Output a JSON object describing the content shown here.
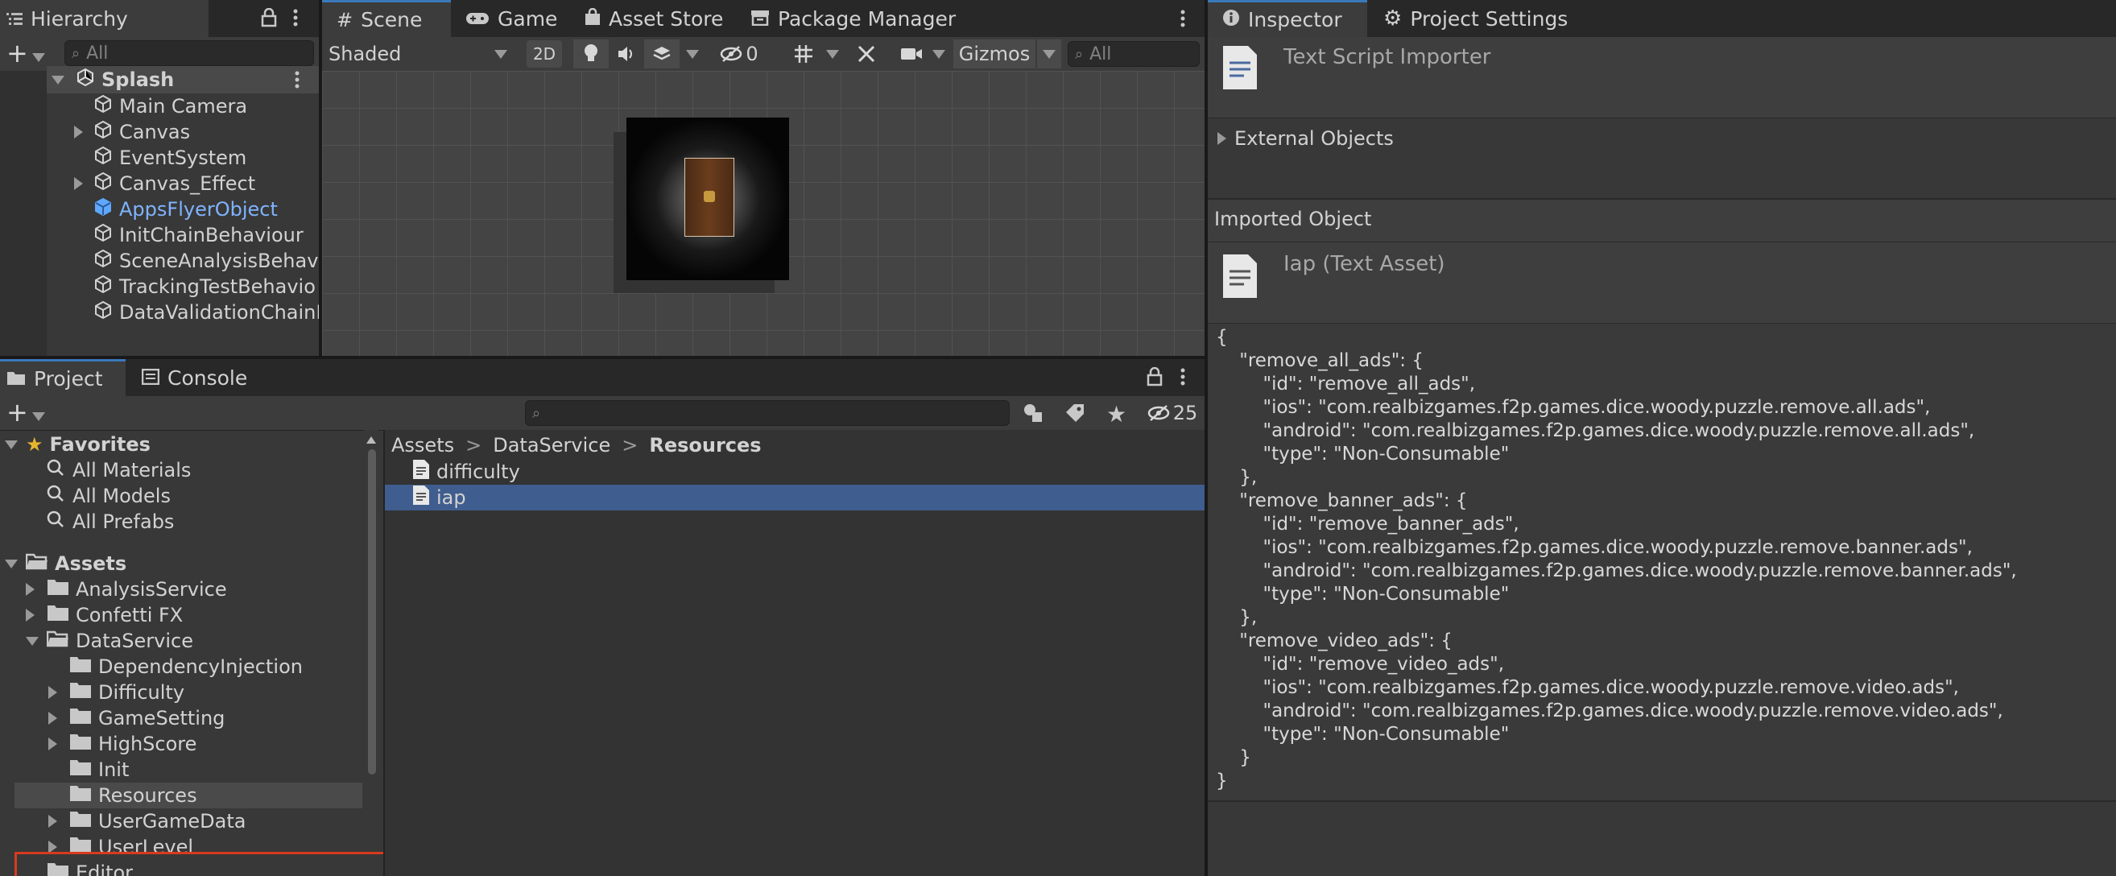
{
  "hierarchy": {
    "tab_label": "Hierarchy",
    "search_placeholder": "All",
    "scene_name": "Splash",
    "items": [
      {
        "label": "Main Camera",
        "expandable": false
      },
      {
        "label": "Canvas",
        "expandable": true
      },
      {
        "label": "EventSystem",
        "expandable": false
      },
      {
        "label": "Canvas_Effect",
        "expandable": true
      },
      {
        "label": "AppsFlyerObject",
        "expandable": false,
        "highlight": true
      },
      {
        "label": "InitChainBehaviour",
        "expandable": false
      },
      {
        "label": "SceneAnalysisBehavi",
        "expandable": false
      },
      {
        "label": "TrackingTestBehavio",
        "expandable": false
      },
      {
        "label": "DataValidationChainB",
        "expandable": false
      }
    ]
  },
  "scene_view": {
    "tabs": [
      "Scene",
      "Game",
      "Asset Store",
      "Package Manager"
    ],
    "shading_mode": "Shaded",
    "btn_2d": "2D",
    "hidden_count": "0",
    "gizmos_label": "Gizmos",
    "search_placeholder": "All"
  },
  "project": {
    "tabs": [
      "Project",
      "Console"
    ],
    "hidden_count": "25",
    "breadcrumb": [
      "Assets",
      "DataService",
      "Resources"
    ],
    "favorites_label": "Favorites",
    "favorites": [
      "All Materials",
      "All Models",
      "All Prefabs"
    ],
    "assets_label": "Assets",
    "tree": [
      {
        "label": "AnalysisService",
        "level": 1,
        "expand": "right"
      },
      {
        "label": "Confetti FX",
        "level": 1,
        "expand": "right"
      },
      {
        "label": "DataService",
        "level": 1,
        "expand": "down",
        "open": true
      },
      {
        "label": "DependencyInjection",
        "level": 2,
        "expand": "none"
      },
      {
        "label": "Difficulty",
        "level": 2,
        "expand": "right"
      },
      {
        "label": "GameSetting",
        "level": 2,
        "expand": "right"
      },
      {
        "label": "HighScore",
        "level": 2,
        "expand": "right"
      },
      {
        "label": "Init",
        "level": 2,
        "expand": "none"
      },
      {
        "label": "Resources",
        "level": 2,
        "expand": "none",
        "selected": true
      },
      {
        "label": "UserGameData",
        "level": 2,
        "expand": "right"
      },
      {
        "label": "UserLevel",
        "level": 2,
        "expand": "right"
      },
      {
        "label": "Editor",
        "level": 1,
        "expand": "none"
      }
    ],
    "files": [
      "difficulty",
      "iap"
    ],
    "selected_file": "iap"
  },
  "inspector": {
    "tabs": [
      "Inspector",
      "Project Settings"
    ],
    "importer_title": "Text Script Importer",
    "external_objects": "External Objects",
    "imported_object_label": "Imported Object",
    "asset_title": "Iap (Text Asset)",
    "content_lines": [
      "{",
      "    \"remove_all_ads\": {",
      "        \"id\": \"remove_all_ads\",",
      "        \"ios\": \"com.realbizgames.f2p.games.dice.woody.puzzle.remove.all.ads\",",
      "        \"android\": \"com.realbizgames.f2p.games.dice.woody.puzzle.remove.all.ads\",",
      "        \"type\": \"Non-Consumable\"",
      "    },",
      "    \"remove_banner_ads\": {",
      "        \"id\": \"remove_banner_ads\",",
      "        \"ios\": \"com.realbizgames.f2p.games.dice.woody.puzzle.remove.banner.ads\",",
      "        \"android\": \"com.realbizgames.f2p.games.dice.woody.puzzle.remove.banner.ads\",",
      "        \"type\": \"Non-Consumable\"",
      "    },",
      "    \"remove_video_ads\": {",
      "        \"id\": \"remove_video_ads\",",
      "        \"ios\": \"com.realbizgames.f2p.games.dice.woody.puzzle.remove.video.ads\",",
      "        \"android\": \"com.realbizgames.f2p.games.dice.woody.puzzle.remove.video.ads\",",
      "        \"type\": \"Non-Consumable\"",
      "    }",
      "}"
    ]
  },
  "colors": {
    "accent_blue": "#3a79bb",
    "selection": "#3f5d8e",
    "highlight_red": "#d93a1f",
    "prefab_blue": "#7fb3ff"
  }
}
